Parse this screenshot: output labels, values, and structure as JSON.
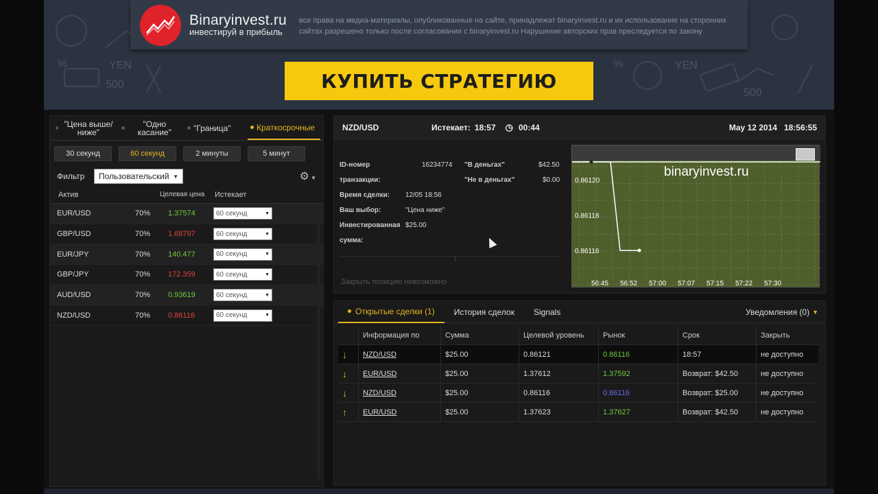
{
  "banner": {
    "brand_name": "Binaryinvest.ru",
    "brand_tagline": "инвестируй в прибыль",
    "copyright_note": "все права на медиа-материалы, опубликованные на сайте, принадлежат binaryinvest.ru и их использование на сторонних сайтах разрешено только после согласования с binaryinvest.ru Нарушение авторских прав преследуется по закону",
    "buy_button": "КУПИТЬ СТРАТЕГИЮ",
    "doodle_text": [
      "YEN",
      "500",
      "%",
      "YEN",
      "500",
      "%"
    ]
  },
  "left": {
    "tabs": [
      "\"Цена выше/ ниже\"",
      "\"Одно касание\"",
      "\"Граница\"",
      "Краткосрочные"
    ],
    "active_tab": 3,
    "durations": [
      "30 секунд",
      "60 секунд",
      "2 минуты",
      "5 минут"
    ],
    "active_duration": 1,
    "filter_label": "Фильтр",
    "filter_value": "Пользовательский",
    "columns": [
      "Актив",
      "Целевая цена",
      "Истекает"
    ],
    "assets": [
      {
        "name": "EUR/USD",
        "payout": "70%",
        "price": "1.37574",
        "dir": "up",
        "expiry": "60 секунд"
      },
      {
        "name": "GBP/USD",
        "payout": "70%",
        "price": "1.68797",
        "dir": "down",
        "expiry": "60 секунд"
      },
      {
        "name": "EUR/JPY",
        "payout": "70%",
        "price": "140.477",
        "dir": "up",
        "expiry": "60 секунд"
      },
      {
        "name": "GBP/JPY",
        "payout": "70%",
        "price": "172.359",
        "dir": "down",
        "expiry": "60 секунд"
      },
      {
        "name": "AUD/USD",
        "payout": "70%",
        "price": "0.93619",
        "dir": "up",
        "expiry": "60 секунд"
      },
      {
        "name": "NZD/USD",
        "payout": "70%",
        "price": "0.86116",
        "dir": "down",
        "expiry": "60 секунд"
      }
    ]
  },
  "trade": {
    "pair": "NZD/USD",
    "expires_label": "Истекает:",
    "expires_time": "18:57",
    "countdown": "00:44",
    "date": "May 12 2014",
    "clock": "18:56:55",
    "id_label": "ID-номер",
    "id_label2": "транзакции:",
    "id_value": "16234774",
    "in_money_label": "\"В деньгах\"",
    "in_money_value": "$42.50",
    "out_money_label": "\"Не в деньгах\"",
    "out_money_value": "$0.00",
    "time_label": "Время сделки:",
    "time_value": "12/05 18:56",
    "choice_label": "Ваш выбор:",
    "choice_value": "\"Цена ниже\"",
    "invested_label": "Инвестированная",
    "invested_label2": "сумма:",
    "invested_value": "$25.00",
    "close_note": "Закрыть позицию невозможно"
  },
  "chart_data": {
    "type": "line",
    "watermark": "binaryinvest.ru",
    "y_ticks": [
      "0.86120",
      "0.86118",
      "0.86116"
    ],
    "x_ticks": [
      "56:45",
      "56:52",
      "57:00",
      "57:07",
      "57:15",
      "57:22",
      "57:30"
    ],
    "series": [
      {
        "values": [
          0.86121,
          0.86121,
          0.86116,
          0.86116,
          0.86116
        ]
      }
    ],
    "colors": {
      "background": "#4f5f2c",
      "line": "#ffffff"
    }
  },
  "orders": {
    "tabs": [
      "Открытые сделки (1)",
      "История сделок",
      "Signals"
    ],
    "notify": "Уведомления (0)",
    "columns": [
      "Информация по",
      "Сумма",
      "Целевой уровень",
      "Рынок",
      "Срок",
      "Закрыть"
    ],
    "rows": [
      {
        "arrow": "↓",
        "pair": "NZD/USD",
        "amount": "$25.00",
        "target": "0.86121",
        "market": "0.86116",
        "market_color": "green",
        "term": "18:57",
        "close": "не доступно"
      },
      {
        "arrow": "↓",
        "pair": "EUR/USD",
        "amount": "$25.00",
        "target": "1.37612",
        "market": "1.37592",
        "market_color": "green",
        "term": "Возврат: $42.50",
        "close": "не доступно"
      },
      {
        "arrow": "↓",
        "pair": "NZD/USD",
        "amount": "$25.00",
        "target": "0.86116",
        "market": "0.86116",
        "market_color": "blue",
        "term": "Возврат: $25.00",
        "close": "не доступно"
      },
      {
        "arrow": "↑",
        "pair": "EUR/USD",
        "amount": "$25.00",
        "target": "1.37623",
        "market": "1.37627",
        "market_color": "green",
        "term": "Возврат: $42.50",
        "close": "не доступно"
      }
    ]
  }
}
